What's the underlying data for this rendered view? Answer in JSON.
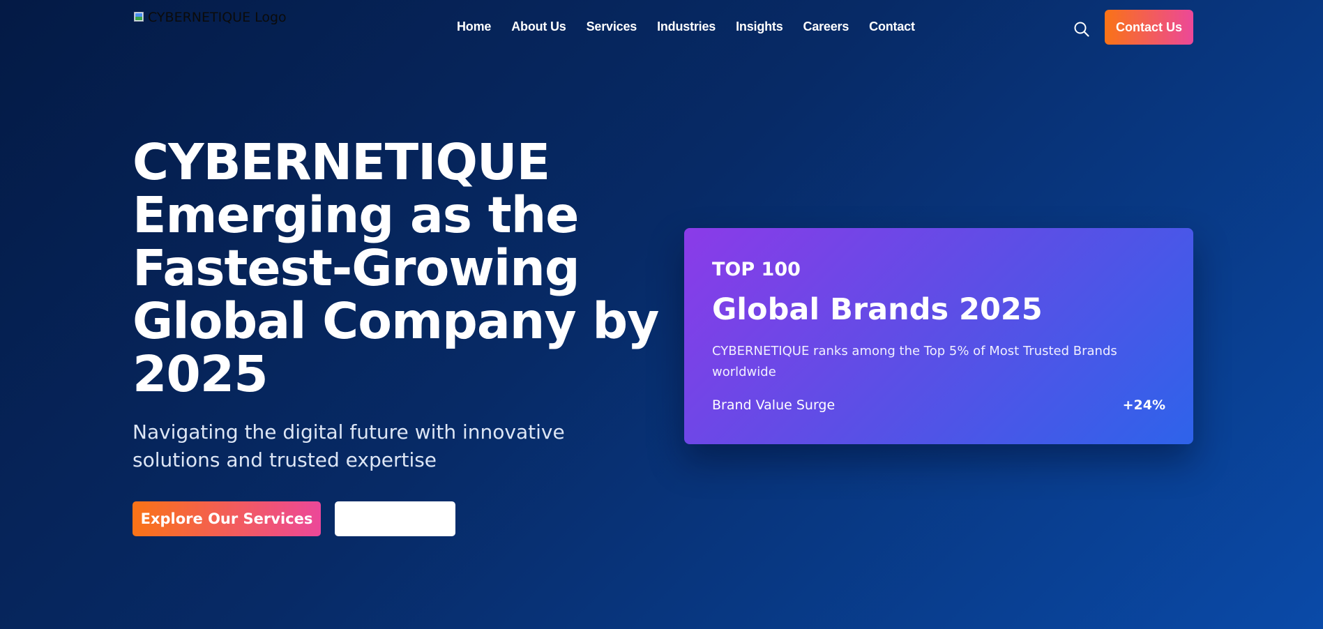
{
  "header": {
    "logo_alt": "CYBERNETIQUE Logo",
    "nav": [
      "Home",
      "About Us",
      "Services",
      "Industries",
      "Insights",
      "Careers",
      "Contact"
    ],
    "search_icon": "search-icon",
    "contact_button": "Contact Us"
  },
  "hero": {
    "title": "CYBERNETIQUE Emerging as the Fastest-Growing Global Company by 2025",
    "subtitle": "Navigating the digital future with innovative solutions and trusted expertise",
    "primary_button": "Explore Our Services",
    "secondary_button": ""
  },
  "card": {
    "kicker": "TOP 100",
    "title": "Global Brands 2025",
    "description": "CYBERNETIQUE ranks among the Top 5% of Most Trusted Brands worldwide",
    "stat_label": "Brand Value Surge",
    "stat_value": "+24%"
  },
  "colors": {
    "background_start": "#041a45",
    "background_end": "#0a4aa8",
    "accent_orange": "#f97316",
    "accent_pink": "#ec4899",
    "card_purple": "#8b3be8",
    "card_blue": "#2e63ea"
  }
}
